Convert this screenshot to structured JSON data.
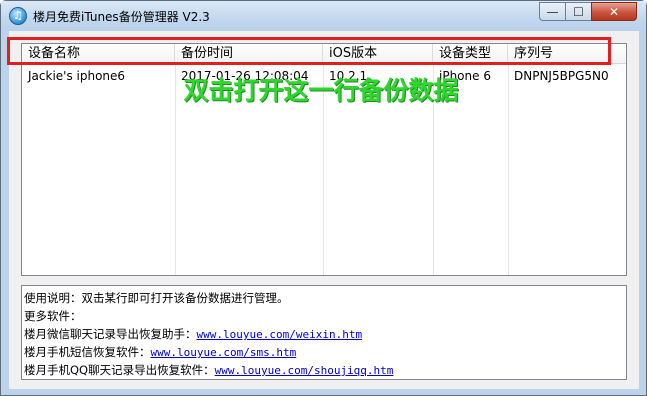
{
  "window": {
    "title": "楼月免费iTunes备份管理器 V2.3",
    "controls": {
      "minimize": "—",
      "maximize": "☐",
      "close": "✕"
    }
  },
  "table": {
    "columns": [
      "设备名称",
      "备份时间",
      "iOS版本",
      "设备类型",
      "序列号"
    ],
    "rows": [
      [
        "Jackie's iphone6",
        "2017-01-26 12:08:04",
        "10.2.1",
        "iPhone 6",
        "DNPNJ5BPG5N0"
      ]
    ]
  },
  "annotation": "双击打开这一行备份数据",
  "info": {
    "usage": "使用说明：双击某行即可打开该备份数据进行管理。",
    "more": "更多软件：",
    "links": [
      {
        "label": "楼月微信聊天记录导出恢复助手：",
        "url": "www.louyue.com/weixin.htm"
      },
      {
        "label": "楼月手机短信恢复软件：",
        "url": "www.louyue.com/sms.htm"
      },
      {
        "label": "楼月手机QQ聊天记录导出恢复软件：",
        "url": "www.louyue.com/shoujiqq.htm"
      }
    ]
  },
  "colors": {
    "highlight": "#e02020",
    "annotation": "#2fd62f",
    "link": "#0000cc"
  }
}
